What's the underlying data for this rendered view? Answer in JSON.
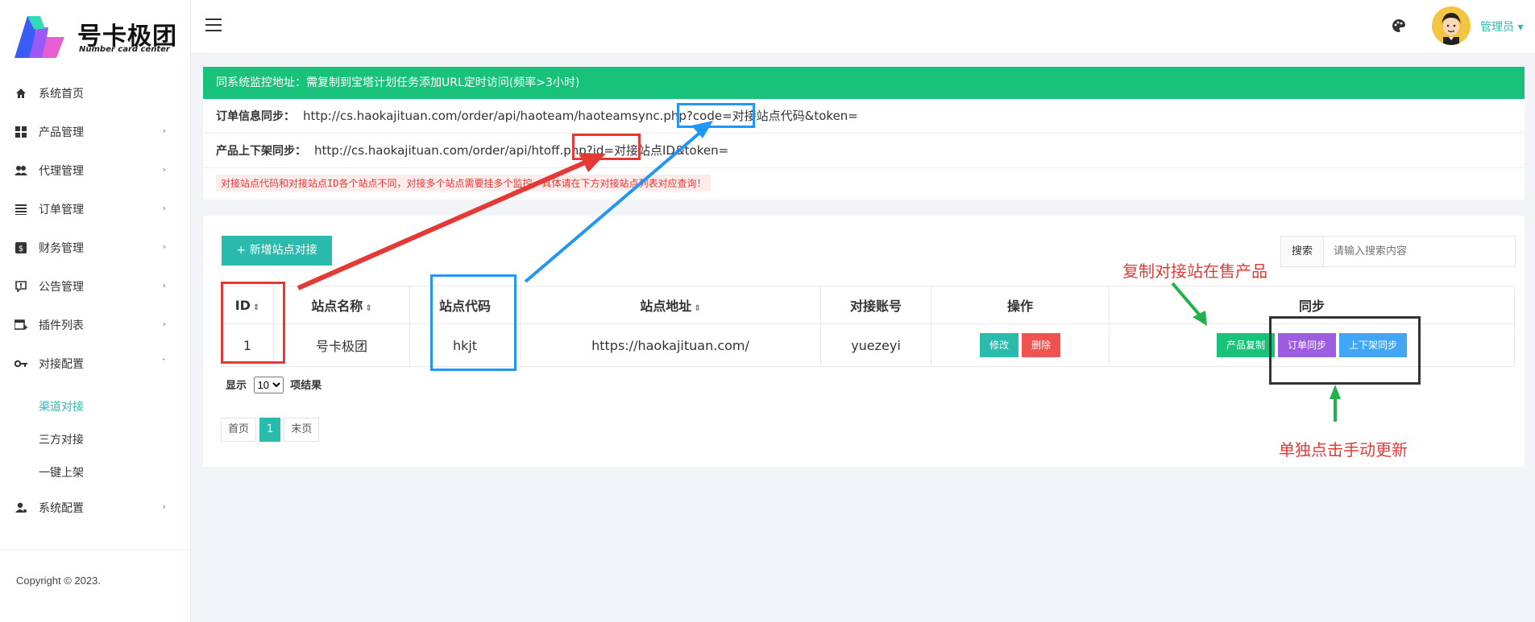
{
  "logo": {
    "title": "号卡极团",
    "subtitle": "Number card center"
  },
  "sidebar": {
    "items": [
      {
        "label": "系统首页",
        "icon": "home-icon"
      },
      {
        "label": "产品管理",
        "icon": "grid-icon"
      },
      {
        "label": "代理管理",
        "icon": "users-icon"
      },
      {
        "label": "订单管理",
        "icon": "list-icon"
      },
      {
        "label": "财务管理",
        "icon": "dollar-icon"
      },
      {
        "label": "公告管理",
        "icon": "announcement-icon"
      },
      {
        "label": "插件列表",
        "icon": "plugin-icon"
      },
      {
        "label": "对接配置",
        "icon": "key-icon"
      }
    ],
    "sub_items": [
      {
        "label": "渠道对接",
        "active": true
      },
      {
        "label": "三方对接",
        "active": false
      },
      {
        "label": "一键上架",
        "active": false
      }
    ],
    "last_item": {
      "label": "系统配置",
      "icon": "user-settings-icon"
    },
    "copyright": "Copyright © 2023."
  },
  "header": {
    "admin_label": "管理员"
  },
  "notice": {
    "bar": "同系统监控地址：需复制到宝塔计划任务添加URL定时访问(频率>3小时)",
    "order_sync_label": "订单信息同步：",
    "order_sync_url_a": "http://cs.haokajituan.com/order/api/haoteam/haoteamsync.php?code=",
    "order_sync_url_code": "对接站点代码",
    "order_sync_url_b": "&token=",
    "product_sync_label": "产品上下架同步：",
    "product_sync_url_a": "http://cs.haokajituan.com/order/api/htoff.php?id=",
    "product_sync_url_id": "对接站点ID",
    "product_sync_url_b": "&token=",
    "warning": "对接站点代码和对接站点ID各个站点不同，对接多个站点需要挂多个监控，具体请在下方对接站点列表对应查询！"
  },
  "main": {
    "add_button": "+ 新增站点对接",
    "search_label": "搜索",
    "search_placeholder": "请输入搜索内容",
    "columns": [
      "ID",
      "站点名称",
      "站点代码",
      "站点地址",
      "对接账号",
      "操作",
      "同步"
    ],
    "row": {
      "id": "1",
      "name": "号卡极团",
      "code": "hkjt",
      "url": "https://haokajituan.com/",
      "account": "yuezeyi",
      "edit": "修改",
      "delete": "删除",
      "copy_products": "产品复制",
      "order_sync": "订单同步",
      "shelf_sync": "上下架同步"
    },
    "length_prefix": "显示",
    "length_value": "10",
    "length_suffix": "项结果",
    "pager": {
      "first": "首页",
      "page": "1",
      "last": "末页"
    }
  },
  "annotations": {
    "copy_note": "复制对接站在售产品",
    "manual_note": "单独点击手动更新",
    "colors": {
      "red": "#e53935",
      "blue": "#2196f3",
      "green": "#22b14c",
      "black": "#333333"
    }
  }
}
